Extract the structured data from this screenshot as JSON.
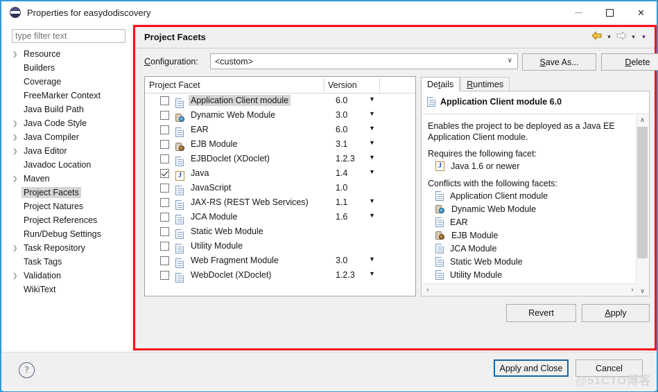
{
  "window": {
    "title": "Properties for easydodiscovery",
    "icon": "eclipse-icon",
    "minimize": "—",
    "maximize": "□",
    "close": "✕"
  },
  "sidebar": {
    "filter_placeholder": "type filter text",
    "filter_value": "",
    "items": [
      {
        "label": "Resource",
        "expandable": true,
        "selected": false
      },
      {
        "label": "Builders",
        "expandable": false,
        "selected": false
      },
      {
        "label": "Coverage",
        "expandable": false,
        "selected": false
      },
      {
        "label": "FreeMarker Context",
        "expandable": false,
        "selected": false
      },
      {
        "label": "Java Build Path",
        "expandable": false,
        "selected": false
      },
      {
        "label": "Java Code Style",
        "expandable": true,
        "selected": false
      },
      {
        "label": "Java Compiler",
        "expandable": true,
        "selected": false
      },
      {
        "label": "Java Editor",
        "expandable": true,
        "selected": false
      },
      {
        "label": "Javadoc Location",
        "expandable": false,
        "selected": false
      },
      {
        "label": "Maven",
        "expandable": true,
        "selected": false
      },
      {
        "label": "Project Facets",
        "expandable": false,
        "selected": true
      },
      {
        "label": "Project Natures",
        "expandable": false,
        "selected": false
      },
      {
        "label": "Project References",
        "expandable": false,
        "selected": false
      },
      {
        "label": "Run/Debug Settings",
        "expandable": false,
        "selected": false
      },
      {
        "label": "Task Repository",
        "expandable": true,
        "selected": false
      },
      {
        "label": "Task Tags",
        "expandable": false,
        "selected": false
      },
      {
        "label": "Validation",
        "expandable": true,
        "selected": false
      },
      {
        "label": "WikiText",
        "expandable": false,
        "selected": false
      }
    ]
  },
  "page": {
    "title": "Project Facets",
    "nav": {
      "back_icon": "back-arrow-icon",
      "back_caret": "▾",
      "forward_icon": "forward-arrow-icon",
      "forward_caret": "▾",
      "menu_caret": "▾"
    },
    "configuration": {
      "label": "Configuration:",
      "value": "<custom>",
      "caret": "∨",
      "save_as_label": "Save As...",
      "delete_label": "Delete"
    },
    "facet_table": {
      "columns": [
        "Project Facet",
        "Version"
      ],
      "rows": [
        {
          "checked": false,
          "icon": "doc-icon",
          "name": "Application Client module",
          "version": "6.0",
          "has_caret": true,
          "selected": true
        },
        {
          "checked": false,
          "icon": "web-icon",
          "name": "Dynamic Web Module",
          "version": "3.0",
          "has_caret": true,
          "selected": false
        },
        {
          "checked": false,
          "icon": "doc-icon",
          "name": "EAR",
          "version": "6.0",
          "has_caret": true,
          "selected": false
        },
        {
          "checked": false,
          "icon": "ejb-icon",
          "name": "EJB Module",
          "version": "3.1",
          "has_caret": true,
          "selected": false
        },
        {
          "checked": false,
          "icon": "doc-icon",
          "name": "EJBDoclet (XDoclet)",
          "version": "1.2.3",
          "has_caret": true,
          "selected": false
        },
        {
          "checked": true,
          "icon": "java-icon",
          "name": "Java",
          "version": "1.4",
          "has_caret": true,
          "selected": false
        },
        {
          "checked": false,
          "icon": "doc-icon",
          "name": "JavaScript",
          "version": "1.0",
          "has_caret": false,
          "selected": false
        },
        {
          "checked": false,
          "icon": "doc-icon",
          "name": "JAX-RS (REST Web Services)",
          "version": "1.1",
          "has_caret": true,
          "selected": false
        },
        {
          "checked": false,
          "icon": "doc-icon",
          "name": "JCA Module",
          "version": "1.6",
          "has_caret": true,
          "selected": false
        },
        {
          "checked": false,
          "icon": "doc-icon",
          "name": "Static Web Module",
          "version": "",
          "has_caret": false,
          "selected": false
        },
        {
          "checked": false,
          "icon": "doc-icon",
          "name": "Utility Module",
          "version": "",
          "has_caret": false,
          "selected": false
        },
        {
          "checked": false,
          "icon": "doc-icon",
          "name": "Web Fragment Module",
          "version": "3.0",
          "has_caret": true,
          "selected": false
        },
        {
          "checked": false,
          "icon": "doc-icon",
          "name": "WebDoclet (XDoclet)",
          "version": "1.2.3",
          "has_caret": true,
          "selected": false
        }
      ]
    },
    "details": {
      "tabs": [
        {
          "label": "Details",
          "active": true
        },
        {
          "label": "Runtimes",
          "active": false
        }
      ],
      "heading": "Application Client module 6.0",
      "heading_icon": "doc-icon",
      "description": "Enables the project to be deployed as a Java EE Application Client module.",
      "requires_label": "Requires the following facet:",
      "requires": [
        {
          "icon": "java-icon",
          "label": "Java 1.6 or newer"
        }
      ],
      "conflicts_label": "Conflicts with the following facets:",
      "conflicts": [
        {
          "icon": "doc-icon",
          "label": "Application Client module"
        },
        {
          "icon": "web-icon",
          "label": "Dynamic Web Module"
        },
        {
          "icon": "doc-icon",
          "label": "EAR"
        },
        {
          "icon": "ejb-icon",
          "label": "EJB Module"
        },
        {
          "icon": "doc-icon",
          "label": "JCA Module"
        },
        {
          "icon": "doc-icon",
          "label": "Static Web Module"
        },
        {
          "icon": "doc-icon",
          "label": "Utility Module"
        }
      ],
      "scroll_up": "∧",
      "scroll_down": "∨",
      "scroll_left": "‹",
      "scroll_right": "›"
    },
    "revert_label": "Revert",
    "apply_label": "Apply"
  },
  "footer": {
    "help_icon": "help-icon",
    "help_glyph": "?",
    "apply_and_close_label": "Apply and Close",
    "cancel_label": "Cancel",
    "watermark": "@51CTO博客"
  },
  "colors": {
    "highlight_border": "#fc0d1b",
    "window_border": "#2e9bd6",
    "default_button_border": "#1565a8",
    "selection": "#d5d5d5"
  }
}
